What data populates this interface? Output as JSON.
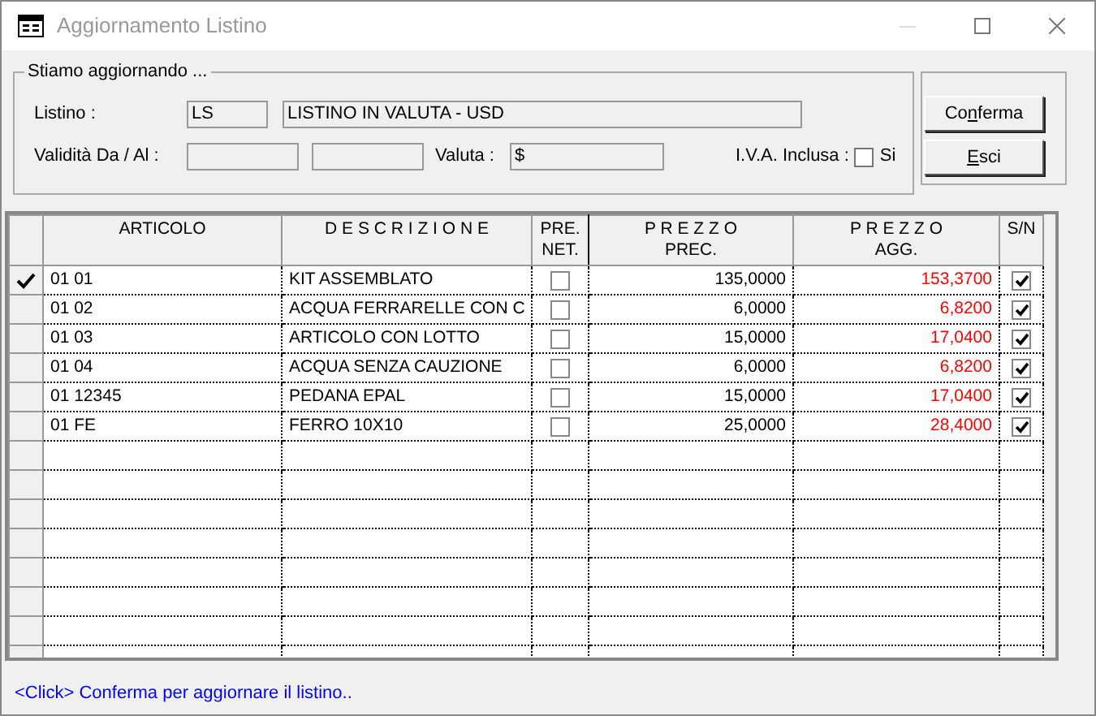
{
  "window": {
    "title": "Aggiornamento Listino"
  },
  "group": {
    "legend": "Stiamo aggiornando ...",
    "listino_label": "Listino :",
    "listino_code": "LS",
    "listino_description": "LISTINO IN VALUTA - USD",
    "validity_label": "Validità Da / Al :",
    "valuta_label": "Valuta :",
    "valuta": "$",
    "iva_label": "I.V.A. Inclusa :",
    "iva_checked": false,
    "iva_option": "Si"
  },
  "buttons": [
    {
      "before": "Co",
      "mnemonic": "n",
      "after": "ferma"
    },
    {
      "mnemonic": "E",
      "after": "sci"
    }
  ],
  "table": {
    "columns": [
      "ARTICOLO",
      "D E S C R I Z I O N E",
      "PRE.\nNET.",
      "P R E Z Z O\nPREC.",
      "P R E Z Z O\nAGG.",
      "S/N"
    ],
    "rows": [
      {
        "selected": true,
        "articolo": "01 01",
        "descrizione": "KIT ASSEMBLATO",
        "pre_net": false,
        "prezzo_prec": "135,0000",
        "prezzo_agg": "153,3700",
        "sn": true
      },
      {
        "selected": false,
        "articolo": "01 02",
        "descrizione": "ACQUA FERRARELLE CON C",
        "pre_net": false,
        "prezzo_prec": "6,0000",
        "prezzo_agg": "6,8200",
        "sn": true
      },
      {
        "selected": false,
        "articolo": "01 03",
        "descrizione": "ARTICOLO CON LOTTO",
        "pre_net": false,
        "prezzo_prec": "15,0000",
        "prezzo_agg": "17,0400",
        "sn": true
      },
      {
        "selected": false,
        "articolo": "01 04",
        "descrizione": "ACQUA SENZA CAUZIONE",
        "pre_net": false,
        "prezzo_prec": "6,0000",
        "prezzo_agg": "6,8200",
        "sn": true
      },
      {
        "selected": false,
        "articolo": "01 12345",
        "descrizione": "PEDANA EPAL",
        "pre_net": false,
        "prezzo_prec": "15,0000",
        "prezzo_agg": "17,0400",
        "sn": true
      },
      {
        "selected": false,
        "articolo": "01 FE",
        "descrizione": "FERRO 10X10",
        "pre_net": false,
        "prezzo_prec": "25,0000",
        "prezzo_agg": "28,4000",
        "sn": true
      }
    ]
  },
  "status_bar": "<Click> Conferma per aggiornare il listino.."
}
